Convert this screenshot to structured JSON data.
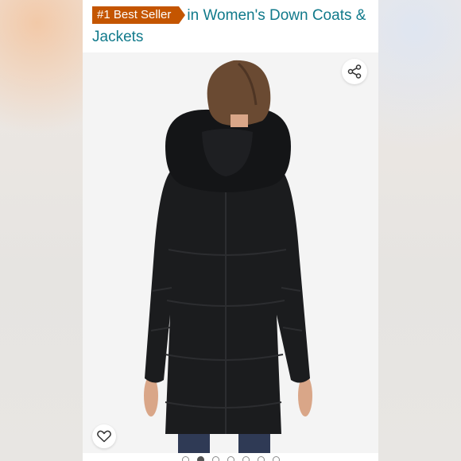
{
  "listing": {
    "badge": "#1 Best Seller",
    "category_text": "in Women's Down Coats & Jackets"
  },
  "icons": {
    "share": "share-icon",
    "wishlist": "heart-icon"
  },
  "gallery": {
    "image_count": 7,
    "active_index": 1
  },
  "colors": {
    "badge": "#c45500",
    "link": "#117a8b"
  }
}
